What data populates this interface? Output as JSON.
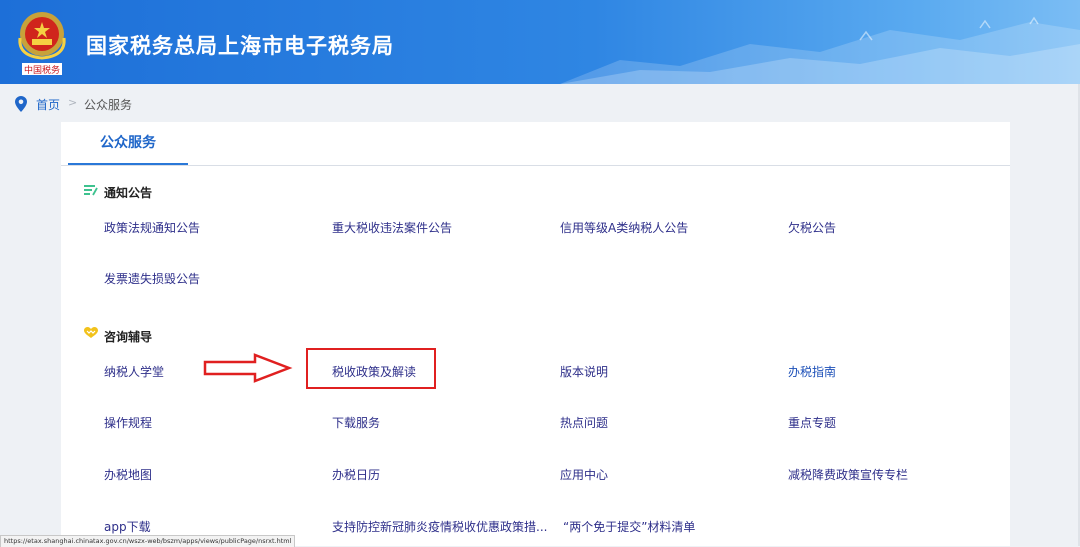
{
  "header": {
    "title": "国家税务总局上海市电子税务局",
    "emblem_caption": "中国税务"
  },
  "breadcrumb": {
    "home": "首页",
    "separator": ">",
    "current": "公众服务"
  },
  "tab": {
    "label": "公众服务"
  },
  "sections": {
    "notices": {
      "title": "通知公告",
      "links": [
        "政策法规通知公告",
        "重大税收违法案件公告",
        "信用等级A类纳税人公告",
        "欠税公告",
        "发票遗失损毁公告"
      ]
    },
    "consult": {
      "title": "咨询辅导",
      "links": [
        "纳税人学堂",
        "税收政策及解读",
        "版本说明",
        "办税指南",
        "操作规程",
        "下载服务",
        "热点问题",
        "重点专题",
        "办税地图",
        "办税日历",
        "应用中心",
        "减税降费政策宣传专栏",
        "app下载",
        "支持防控新冠肺炎疫情税收优惠政策措...",
        "“两个免于提交”材料清单"
      ]
    }
  },
  "status": {
    "url": "https://etax.shanghai.chinatax.gov.cn/wszx-web/bszm/apps/views/publicPage/nsrxt.html"
  },
  "colors": {
    "header_left": "#1d6fd8",
    "header_right": "#7bbdf4",
    "accent": "#2a78d8",
    "annotation": "#e02020",
    "link": "#2e2f8a"
  },
  "icons": {
    "emblem": "national-emblem-icon",
    "pin": "location-pin-icon",
    "notices": "notice-lines-icon",
    "consult": "heart-hands-icon",
    "annotation_arrow": "right-arrow-icon"
  }
}
